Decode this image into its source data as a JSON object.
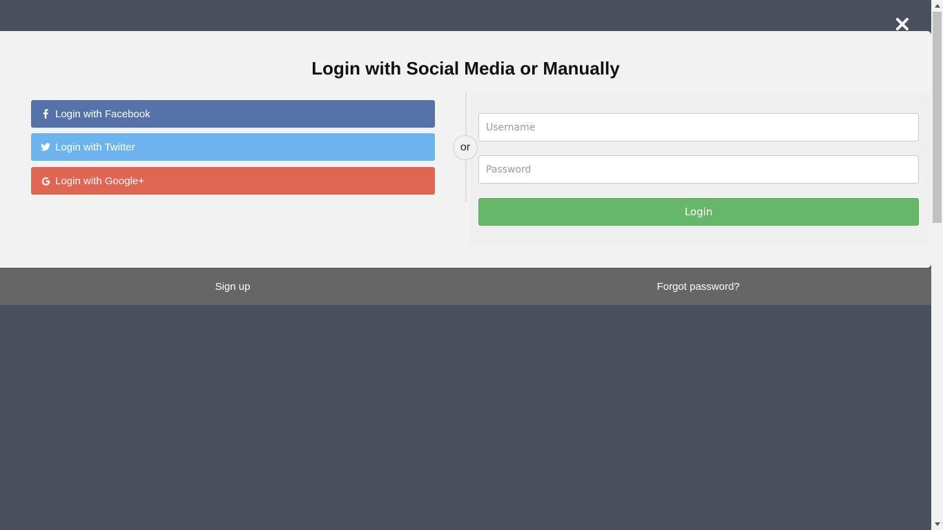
{
  "modal": {
    "title": "Login with Social Media or Manually"
  },
  "social": {
    "facebook_label": "Login with Facebook",
    "twitter_label": "Login with Twitter",
    "google_label": "Login with Google+",
    "facebook_icon": "facebook-icon",
    "twitter_icon": "twitter-icon",
    "google_icon": "google-icon"
  },
  "divider": {
    "or_label": "or"
  },
  "manual": {
    "username_placeholder": "Username",
    "username_value": "",
    "password_placeholder": "Password",
    "password_value": "",
    "login_label": "Login"
  },
  "footer": {
    "signup_label": "Sign up",
    "forgot_label": "Forgot password?"
  },
  "colors": {
    "background": "#4a4f5e",
    "facebook": "#5572a8",
    "twitter": "#6bb4ee",
    "google": "#e06553",
    "login": "#66b868",
    "footer": "#666666"
  }
}
